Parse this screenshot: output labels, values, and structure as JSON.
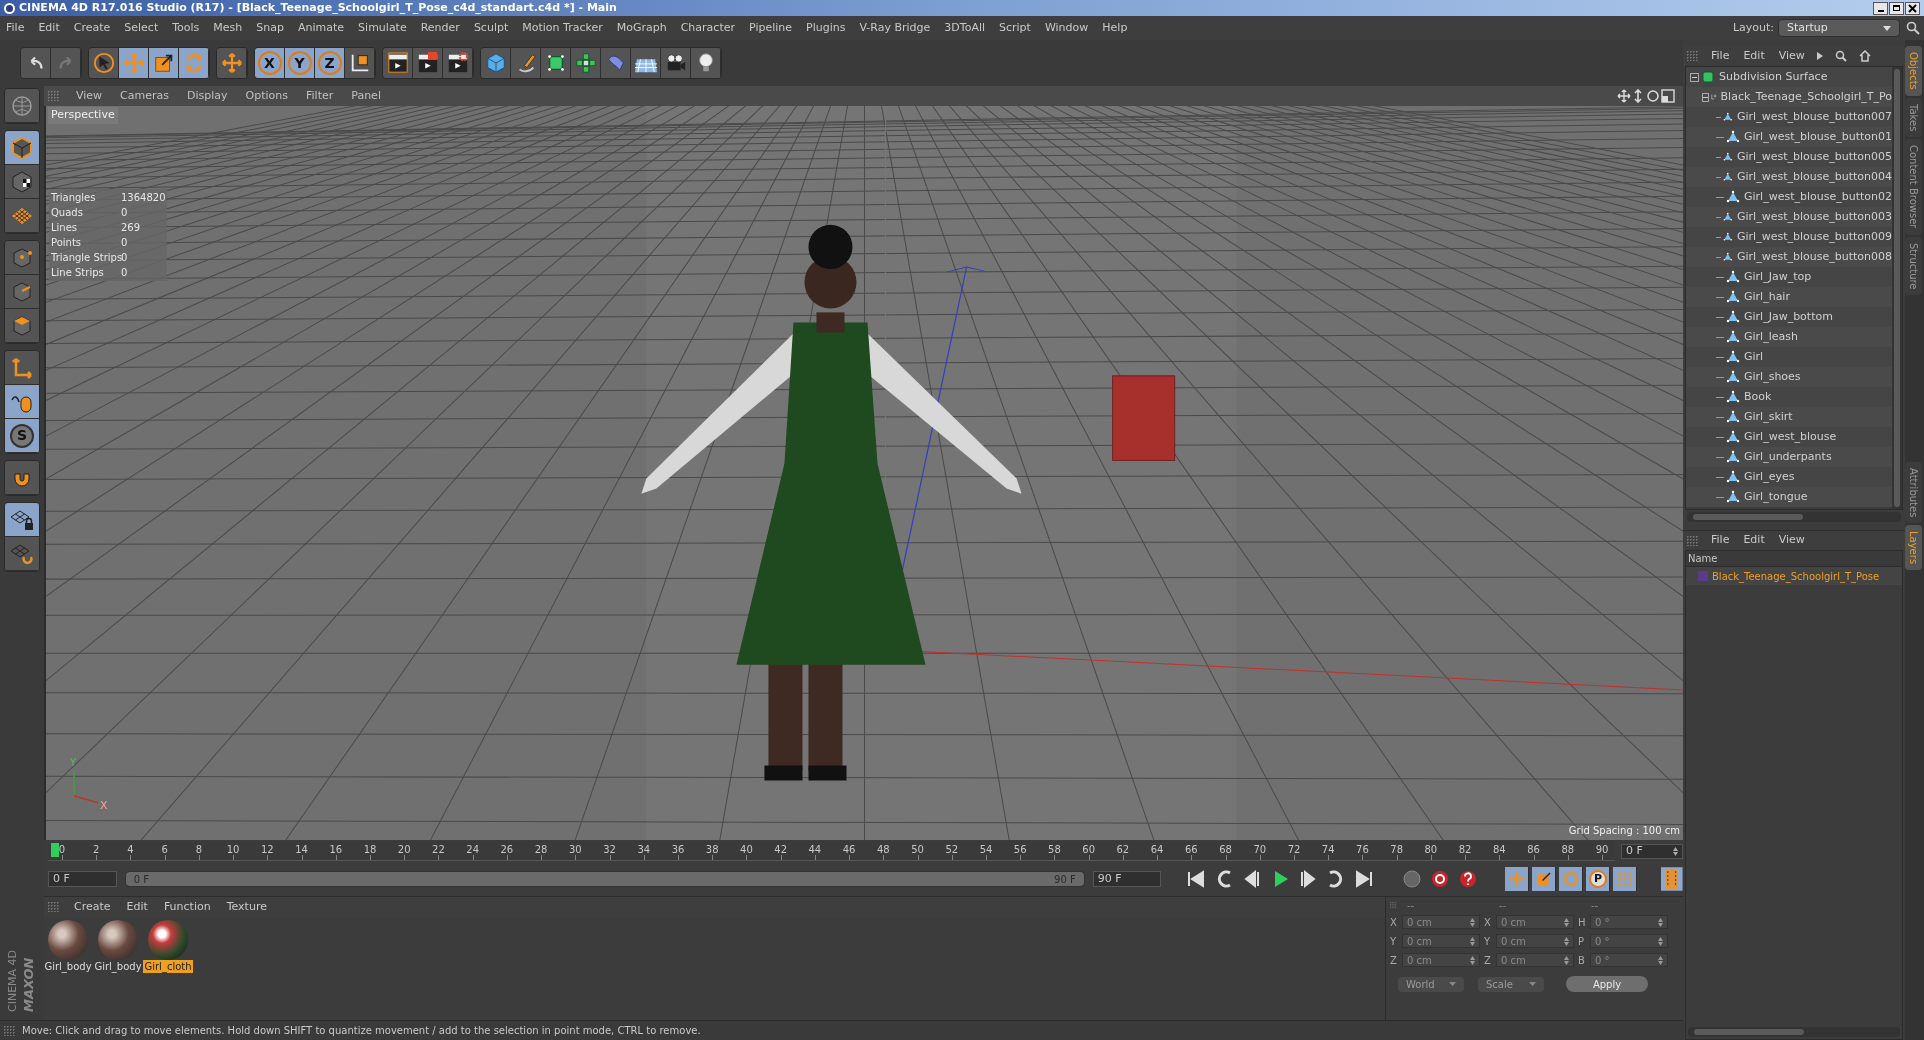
{
  "window": {
    "title": "CINEMA 4D R17.016 Studio (R17) - [Black_Teenage_Schoolgirl_T_Pose_c4d_standart.c4d *] - Main"
  },
  "menu": [
    "File",
    "Edit",
    "Create",
    "Select",
    "Tools",
    "Mesh",
    "Snap",
    "Animate",
    "Simulate",
    "Render",
    "Sculpt",
    "Motion Tracker",
    "MoGraph",
    "Character",
    "Pipeline",
    "Plugins",
    "V-Ray Bridge",
    "3DToAll",
    "Script",
    "Window",
    "Help"
  ],
  "layout": {
    "label": "Layout:",
    "value": "Startup"
  },
  "toolbar": [
    {
      "tools": [
        {
          "kind": "undo",
          "selected": false
        },
        {
          "kind": "redo",
          "selected": false
        }
      ]
    },
    {
      "tools": [
        {
          "kind": "select",
          "selected": false
        },
        {
          "kind": "move",
          "selected": true
        },
        {
          "kind": "scale",
          "selected": true
        },
        {
          "kind": "rotate",
          "selected": true
        }
      ]
    },
    {
      "tools": [
        {
          "kind": "add",
          "selected": false
        }
      ]
    },
    {
      "tools": [
        {
          "kind": "axis",
          "label": "X",
          "selected": true
        },
        {
          "kind": "axis",
          "label": "Y",
          "selected": true
        },
        {
          "kind": "axis",
          "label": "Z",
          "selected": true
        },
        {
          "kind": "coord",
          "selected": false
        }
      ]
    },
    {
      "tools": [
        {
          "kind": "renderview",
          "selected": false
        },
        {
          "kind": "render",
          "selected": false
        },
        {
          "kind": "rendersettings",
          "selected": false
        }
      ]
    },
    {
      "tools": [
        {
          "kind": "cube",
          "selected": false
        },
        {
          "kind": "pen",
          "selected": false
        },
        {
          "kind": "subdiv",
          "selected": false
        },
        {
          "kind": "array",
          "selected": false
        },
        {
          "kind": "deformer",
          "selected": false
        },
        {
          "kind": "floor",
          "selected": false
        },
        {
          "kind": "camera",
          "selected": false
        },
        {
          "kind": "light",
          "selected": false
        }
      ]
    }
  ],
  "left_tools": [
    {
      "tools": [
        {
          "kind": "globe",
          "selected": false
        }
      ]
    },
    {
      "tools": [
        {
          "kind": "model",
          "selected": true
        },
        {
          "kind": "texture",
          "selected": false
        },
        {
          "kind": "workplane",
          "selected": false
        }
      ]
    },
    {
      "tools": [
        {
          "kind": "points",
          "selected": false
        },
        {
          "kind": "edges",
          "selected": false
        },
        {
          "kind": "polygons",
          "selected": false
        }
      ]
    },
    {
      "tools": [
        {
          "kind": "axiscorner",
          "selected": false
        },
        {
          "kind": "tweak",
          "selected": true
        },
        {
          "kind": "solo",
          "label": "S",
          "selected": true
        }
      ]
    },
    {
      "tools": [
        {
          "kind": "magnet",
          "selected": false
        }
      ]
    },
    {
      "tools": [
        {
          "kind": "gridlock",
          "selected": true
        },
        {
          "kind": "gridrotate",
          "selected": false
        }
      ]
    }
  ],
  "viewport": {
    "menu": [
      "View",
      "Cameras",
      "Display",
      "Options",
      "Filter",
      "Panel"
    ],
    "camera": "Perspective",
    "stats": [
      {
        "label": "Triangles",
        "value": "1364820"
      },
      {
        "label": "Quads",
        "value": "0"
      },
      {
        "label": "Lines",
        "value": "269"
      },
      {
        "label": "Points",
        "value": "0"
      },
      {
        "label": "Triangle Strips",
        "value": "0"
      },
      {
        "label": "Line Strips",
        "value": "0"
      }
    ],
    "grid_spacing": "Grid Spacing : 100 cm",
    "axis_labels": [
      "Y",
      "X"
    ]
  },
  "timeline": {
    "ticks": [
      "0",
      "2",
      "4",
      "6",
      "8",
      "10",
      "12",
      "14",
      "16",
      "18",
      "20",
      "22",
      "24",
      "26",
      "28",
      "30",
      "32",
      "34",
      "36",
      "38",
      "40",
      "42",
      "44",
      "46",
      "48",
      "50",
      "52",
      "54",
      "56",
      "58",
      "60",
      "62",
      "64",
      "66",
      "68",
      "70",
      "72",
      "74",
      "76",
      "78",
      "80",
      "82",
      "84",
      "86",
      "88",
      "90"
    ],
    "current": "0 F",
    "start": "0 F",
    "slider": {
      "start": "0 F",
      "end": "90 F",
      "level": 1
    },
    "end": "90 F",
    "keys": [
      {
        "kind": "keymove",
        "selected": true
      },
      {
        "kind": "keyscale",
        "selected": true
      },
      {
        "kind": "keyrotate",
        "selected": true
      },
      {
        "kind": "keyparam",
        "label": "P",
        "selected": true
      },
      {
        "kind": "keygrid",
        "selected": true
      }
    ]
  },
  "materials": {
    "menu": [
      "Create",
      "Edit",
      "Function",
      "Texture"
    ],
    "items": [
      {
        "name": "Girl_body",
        "kind": "skin",
        "selected": false
      },
      {
        "name": "Girl_body",
        "kind": "skin",
        "selected": false
      },
      {
        "name": "Girl_cloth",
        "kind": "cloth",
        "selected": true
      }
    ]
  },
  "coordinates": {
    "headers": [
      "--",
      "--",
      "--"
    ],
    "rows": [
      [
        {
          "axis": "X",
          "value": "0 cm"
        },
        {
          "axis": "X",
          "value": "0 cm"
        },
        {
          "axis": "H",
          "value": "0 °"
        }
      ],
      [
        {
          "axis": "Y",
          "value": "0 cm"
        },
        {
          "axis": "Y",
          "value": "0 cm"
        },
        {
          "axis": "P",
          "value": "0 °"
        }
      ],
      [
        {
          "axis": "Z",
          "value": "0 cm"
        },
        {
          "axis": "Z",
          "value": "0 cm"
        },
        {
          "axis": "B",
          "value": "0 °"
        }
      ]
    ],
    "mode": "World",
    "scale": "Scale",
    "apply": "Apply",
    "disabled": true
  },
  "status_bar": "Move: Click and drag to move elements. Hold down SHIFT to quantize movement / add to the selection in point mode, CTRL to remove.",
  "logo": [
    "MAXON",
    "CINEMA 4D"
  ],
  "object_manager": {
    "menu": [
      "File",
      "Edit",
      "View"
    ],
    "tree": [
      {
        "name": "Subdivision Surface",
        "kind": "subdivision",
        "expanded": true,
        "children": [
          {
            "name": "Black_Teenage_Schoolgirl_T_Po",
            "kind": "null",
            "expanded": true,
            "children": [
              {
                "name": "Girl_west_blouse_button007",
                "kind": "polygon"
              },
              {
                "name": "Girl_west_blouse_button01",
                "kind": "polygon"
              },
              {
                "name": "Girl_west_blouse_button005",
                "kind": "polygon"
              },
              {
                "name": "Girl_west_blouse_button004",
                "kind": "polygon"
              },
              {
                "name": "Girl_west_blouse_button02",
                "kind": "polygon"
              },
              {
                "name": "Girl_west_blouse_button003",
                "kind": "polygon"
              },
              {
                "name": "Girl_west_blouse_button009",
                "kind": "polygon"
              },
              {
                "name": "Girl_west_blouse_button008",
                "kind": "polygon"
              },
              {
                "name": "Girl_Jaw_top",
                "kind": "polygon"
              },
              {
                "name": "Girl_hair",
                "kind": "polygon"
              },
              {
                "name": "Girl_Jaw_bottom",
                "kind": "polygon"
              },
              {
                "name": "Girl_leash",
                "kind": "polygon"
              },
              {
                "name": "Girl",
                "kind": "polygon"
              },
              {
                "name": "Girl_shoes",
                "kind": "polygon"
              },
              {
                "name": "Book",
                "kind": "polygon"
              },
              {
                "name": "Girl_skirt",
                "kind": "polygon"
              },
              {
                "name": "Girl_west_blouse",
                "kind": "polygon"
              },
              {
                "name": "Girl_underpants",
                "kind": "polygon"
              },
              {
                "name": "Girl_eyes",
                "kind": "polygon"
              },
              {
                "name": "Girl_tongue",
                "kind": "polygon"
              }
            ]
          }
        ]
      }
    ]
  },
  "side_tabs": [
    {
      "label": "Objects",
      "selected": true
    },
    {
      "label": "Takes",
      "selected": false
    },
    {
      "label": "Content Browser",
      "selected": false
    },
    {
      "label": "Structure",
      "selected": false
    }
  ],
  "layer_manager": {
    "menu": [
      "File",
      "Edit",
      "View"
    ],
    "column": "Name",
    "rows": [
      {
        "name": "Black_Teenage_Schoolgirl_T_Pose",
        "color": "#5b3a8c"
      }
    ]
  },
  "lower_side_tabs": [
    {
      "label": "Attributes",
      "selected": false
    },
    {
      "label": "Layers",
      "selected": true
    }
  ]
}
